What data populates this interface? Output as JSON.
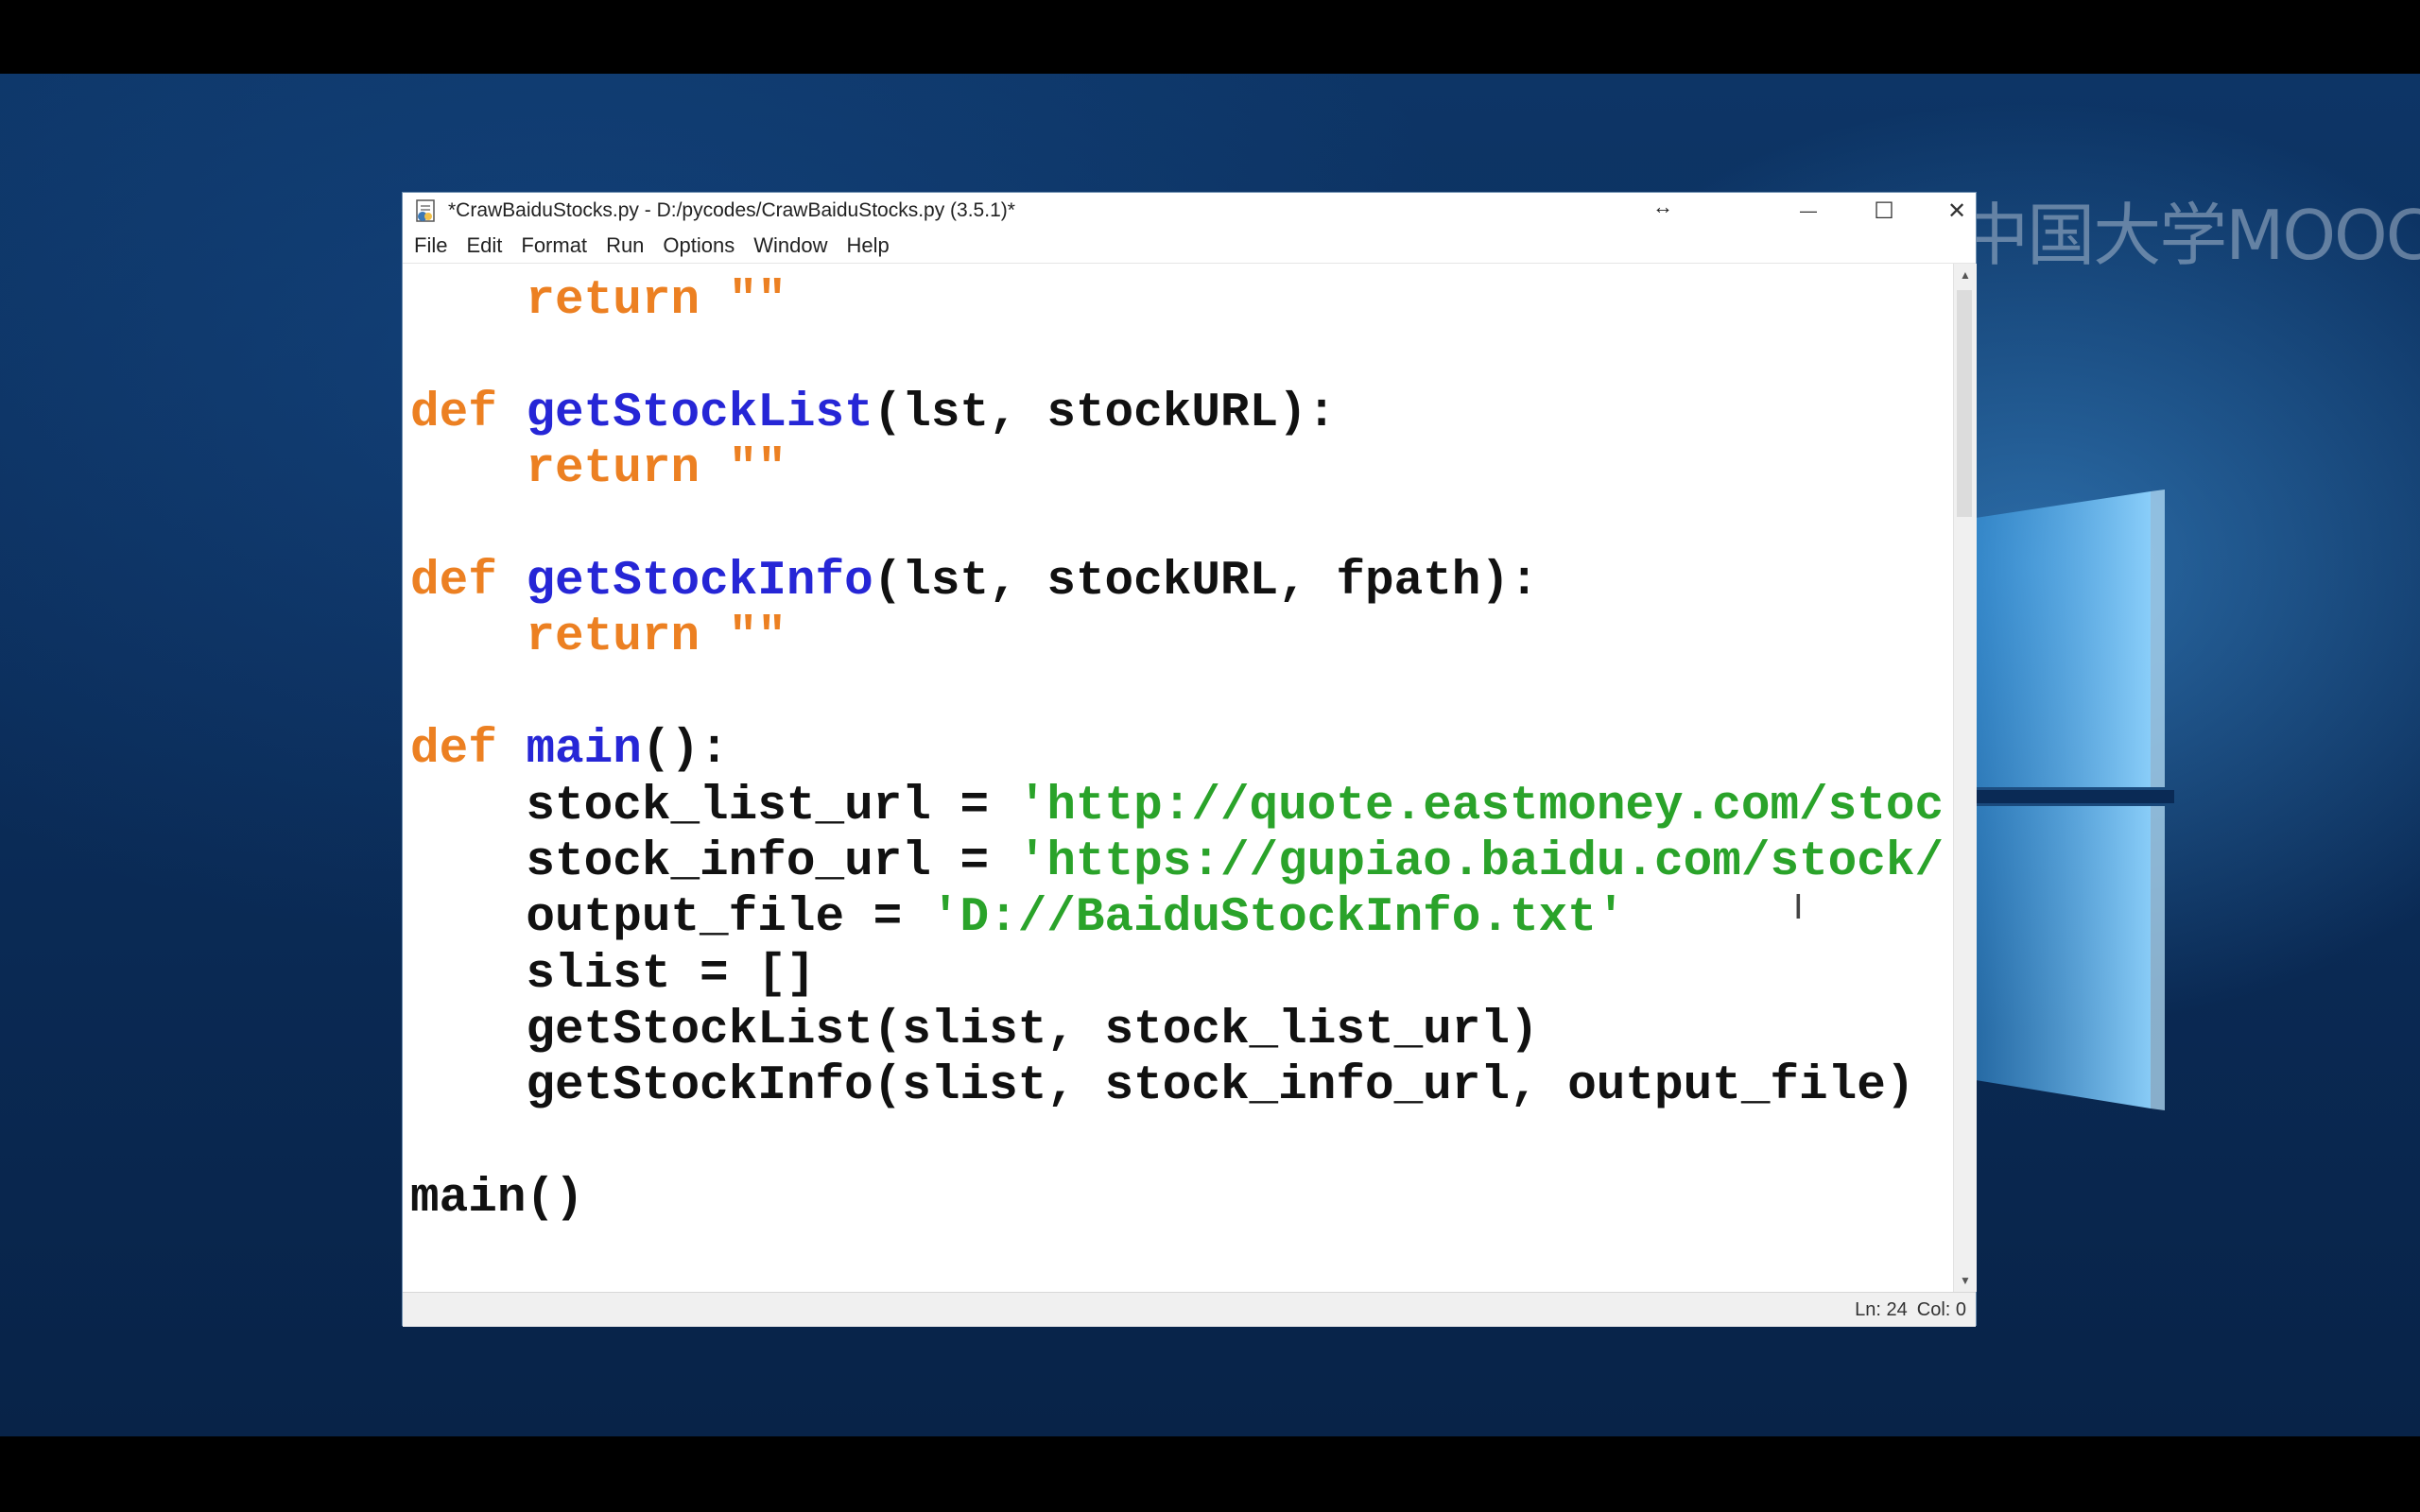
{
  "window": {
    "title": "*CrawBaiduStocks.py - D:/pycodes/CrawBaiduStocks.py (3.5.1)*",
    "minimize_glyph": "—",
    "maximize_glyph": "☐",
    "close_glyph": "✕",
    "resize_glyph": "↔"
  },
  "menu": [
    "File",
    "Edit",
    "Format",
    "Run",
    "Options",
    "Window",
    "Help"
  ],
  "code_lines": [
    [
      {
        "t": "    "
      },
      {
        "t": "return",
        "c": "kw"
      },
      {
        "t": " "
      },
      {
        "t": "\"\"",
        "c": "str_kw"
      }
    ],
    [],
    [
      {
        "t": "def",
        "c": "kw"
      },
      {
        "t": " "
      },
      {
        "t": "getStockList",
        "c": "fn"
      },
      {
        "t": "(lst, stockURL):"
      }
    ],
    [
      {
        "t": "    "
      },
      {
        "t": "return",
        "c": "kw"
      },
      {
        "t": " "
      },
      {
        "t": "\"\"",
        "c": "str_kw"
      }
    ],
    [],
    [
      {
        "t": "def",
        "c": "kw"
      },
      {
        "t": " "
      },
      {
        "t": "getStockInfo",
        "c": "fn"
      },
      {
        "t": "(lst, stockURL, fpath):"
      }
    ],
    [
      {
        "t": "    "
      },
      {
        "t": "return",
        "c": "kw"
      },
      {
        "t": " "
      },
      {
        "t": "\"\"",
        "c": "str_kw"
      }
    ],
    [],
    [
      {
        "t": "def",
        "c": "kw"
      },
      {
        "t": " "
      },
      {
        "t": "main",
        "c": "fn"
      },
      {
        "t": "():"
      }
    ],
    [
      {
        "t": "    stock_list_url = "
      },
      {
        "t": "'http://quote.eastmoney.com/stoc",
        "c": "str"
      }
    ],
    [
      {
        "t": "    stock_info_url = "
      },
      {
        "t": "'https://gupiao.baidu.com/stock/",
        "c": "str"
      }
    ],
    [
      {
        "t": "    output_file = "
      },
      {
        "t": "'D://BaiduStockInfo.txt'",
        "c": "str"
      }
    ],
    [
      {
        "t": "    slist = []"
      }
    ],
    [
      {
        "t": "    getStockList(slist, stock_list_url)"
      }
    ],
    [
      {
        "t": "    getStockInfo(slist, stock_info_url, output_file)"
      }
    ],
    [],
    [
      {
        "t": "main()"
      }
    ]
  ],
  "status": {
    "line": "Ln: 24",
    "col": "Col: 0"
  },
  "watermark": {
    "text": "中国大学MOOC"
  },
  "colors": {
    "keyword": "#ec8022",
    "function": "#2626d6",
    "string": "#2aa32a"
  }
}
